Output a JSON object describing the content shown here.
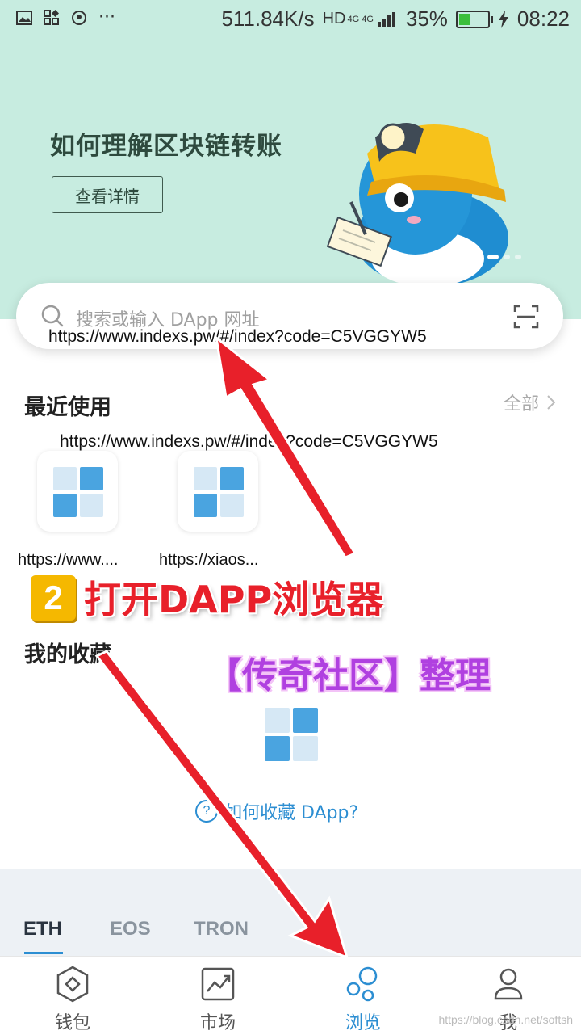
{
  "status_bar": {
    "speed": "511.84K/s",
    "network": "HD",
    "network_sub": "4G 4G",
    "battery": "35%",
    "time": "08:22",
    "icons": [
      "image-icon",
      "apps-icon",
      "location-icon",
      "more-icon",
      "signal-icon",
      "battery-icon",
      "charging-icon"
    ]
  },
  "banner": {
    "title": "如何理解区块链转账",
    "button": "查看详情"
  },
  "search": {
    "placeholder": "搜索或输入 DApp 网址",
    "overlay_url": "https://www.indexs.pw/#/index?code=C5VGGYW5"
  },
  "recent": {
    "title": "最近使用",
    "all_label": "全部",
    "overlay_url": "https://www.indexs.pw/#/index?code=C5VGGYW5",
    "apps": [
      {
        "label": "https://www...."
      },
      {
        "label": "https://xiaos..."
      }
    ]
  },
  "favorites": {
    "title": "我的收藏",
    "howto": "如何收藏 DApp?",
    "howto_icon": "?"
  },
  "annotations": {
    "step_number": "2",
    "step_text": "打开DAPP浏览器",
    "credit": "【传奇社区】整理",
    "colors": {
      "arrow": "#e8202a",
      "step": "#e8202a",
      "credit": "#b040e0",
      "badge": "#f5b800"
    }
  },
  "chain_tabs": [
    {
      "label": "ETH",
      "active": true
    },
    {
      "label": "EOS",
      "active": false
    },
    {
      "label": "TRON",
      "active": false
    }
  ],
  "bottom_nav": [
    {
      "label": "钱包",
      "icon": "wallet-icon",
      "active": false
    },
    {
      "label": "市场",
      "icon": "market-icon",
      "active": false
    },
    {
      "label": "浏览",
      "icon": "browse-icon",
      "active": true
    },
    {
      "label": "我",
      "icon": "profile-icon",
      "active": false
    }
  ],
  "watermark": "https://blog.csdn.net/softsh",
  "colors": {
    "accent": "#2c8ed2",
    "banner_bg": "#c7ece0",
    "tab_bg": "#edf1f5"
  }
}
